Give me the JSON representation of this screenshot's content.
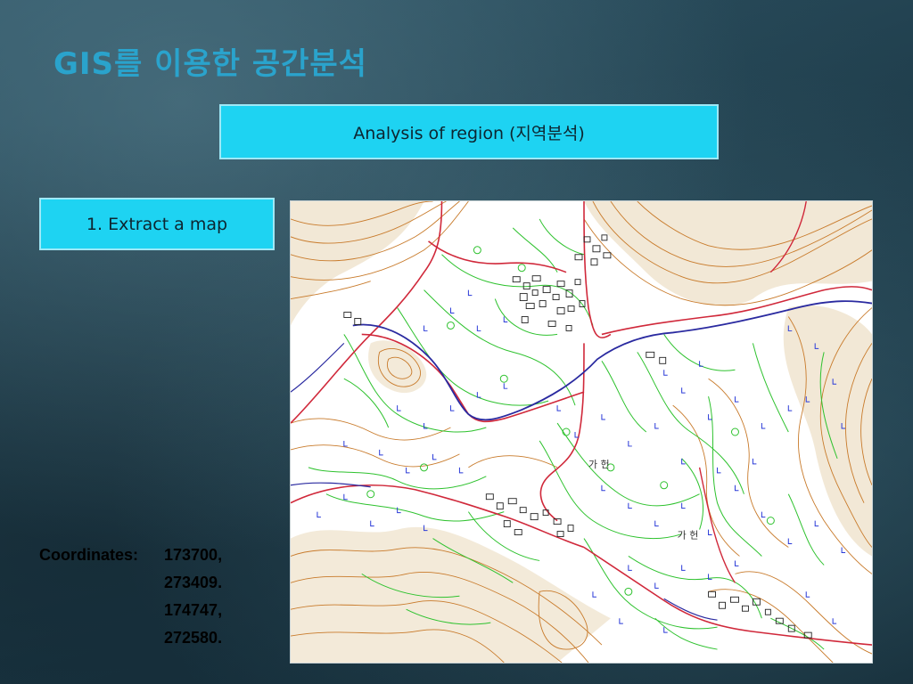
{
  "slide": {
    "title": "GIS를 이용한 공간분석",
    "region_label": "Analysis of region (지역분석)",
    "step_label": "1. Extract a map",
    "coordinates_label": "Coordinates:",
    "coordinates": [
      "173700,",
      "273409.",
      "174747,",
      "272580."
    ]
  },
  "map": {
    "labels": [
      "가 헌",
      "가 헌"
    ],
    "colors": {
      "contour": "#c87a2a",
      "road": "#d0283a",
      "highway": "#2a2aa0",
      "vegetation": "#2ec22e",
      "symbol": "#2a3ad8",
      "building": "#222222",
      "hill": "#e8d6b4"
    }
  }
}
